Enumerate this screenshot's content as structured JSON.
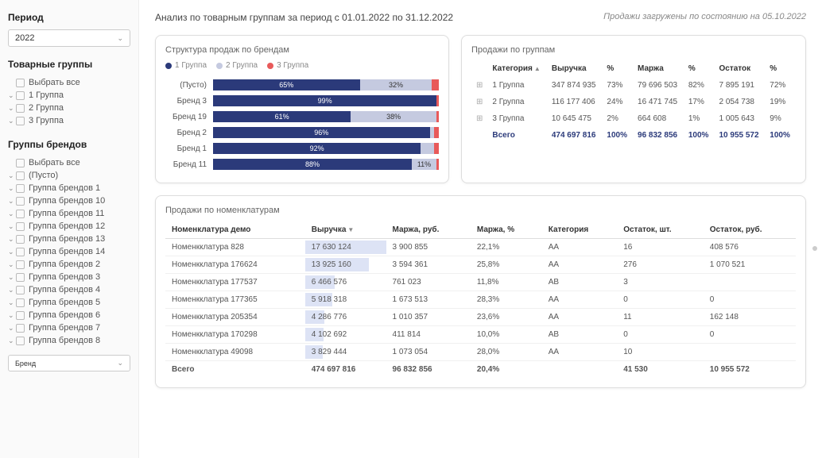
{
  "sidebar": {
    "period_label": "Период",
    "period_value": "2022",
    "groups_label": "Товарные группы",
    "select_all": "Выбрать все",
    "groups": [
      "1 Группа",
      "2 Группа",
      "3 Группа"
    ],
    "brands_label": "Группы брендов",
    "empty": "(Пусто)",
    "brand_groups": [
      "Группа брендов 1",
      "Группа брендов 10",
      "Группа брендов 11",
      "Группа брендов 12",
      "Группа брендов 13",
      "Группа брендов 14",
      "Группа брендов 2",
      "Группа брендов 3",
      "Группа брендов 4",
      "Группа брендов 5",
      "Группа брендов 6",
      "Группа брендов 7",
      "Группа брендов 8"
    ],
    "dropdown": "Бренд"
  },
  "header": {
    "title": "Анализ по товарным группам за период с 01.01.2022 по 31.12.2022",
    "loaded": "Продажи загружены по состоянию на 05.10.2022"
  },
  "chart": {
    "title": "Структура продаж по брендам",
    "legend": {
      "g1": "1 Группа",
      "g2": "2 Группа",
      "g3": "3 Группа"
    }
  },
  "chart_data": {
    "type": "bar",
    "orientation": "horizontal-stacked",
    "categories": [
      "(Пусто)",
      "Бренд 3",
      "Бренд 19",
      "Бренд 2",
      "Бренд 1",
      "Бренд 11"
    ],
    "series": [
      {
        "name": "1 Группа",
        "color": "#2b3a7a",
        "values": [
          65,
          99,
          61,
          96,
          92,
          88
        ]
      },
      {
        "name": "2 Группа",
        "color": "#c5cae0",
        "values": [
          32,
          0,
          38,
          2,
          6,
          11
        ]
      },
      {
        "name": "3 Группа",
        "color": "#e85a5a",
        "values": [
          3,
          1,
          1,
          2,
          2,
          1
        ]
      }
    ],
    "labels": [
      [
        "65%",
        "32%",
        ""
      ],
      [
        "99%",
        "",
        ""
      ],
      [
        "61%",
        "38%",
        ""
      ],
      [
        "96%",
        "",
        ""
      ],
      [
        "92%",
        "",
        ""
      ],
      [
        "88%",
        "11%",
        ""
      ]
    ]
  },
  "groups_table": {
    "title": "Продажи по группам",
    "headers": [
      "Категория",
      "Выручка",
      "%",
      "Маржа",
      "%",
      "Остаток",
      "%"
    ],
    "rows": [
      {
        "cat": "1 Группа",
        "rev": "347 874 935",
        "revp": "73%",
        "mar": "79 696 503",
        "marp": "82%",
        "rem": "7 895 191",
        "remp": "72%"
      },
      {
        "cat": "2 Группа",
        "rev": "116 177 406",
        "revp": "24%",
        "mar": "16 471 745",
        "marp": "17%",
        "rem": "2 054 738",
        "remp": "19%"
      },
      {
        "cat": "3 Группа",
        "rev": "10 645 475",
        "revp": "2%",
        "mar": "664 608",
        "marp": "1%",
        "rem": "1 005 643",
        "remp": "9%"
      }
    ],
    "total": {
      "cat": "Всего",
      "rev": "474 697 816",
      "revp": "100%",
      "mar": "96 832 856",
      "marp": "100%",
      "rem": "10 955 572",
      "remp": "100%"
    }
  },
  "nom_table": {
    "title": "Продажи по номенклатурам",
    "headers": [
      "Номенклатура демо",
      "Выручка",
      "Маржа, руб.",
      "Маржа, %",
      "Категория",
      "Остаток, шт.",
      "Остаток, руб."
    ],
    "rows": [
      {
        "n": "Номенкклатура 828",
        "rev": "17 630 124",
        "bar": 100,
        "mar": "3 900 855",
        "mp": "22,1%",
        "cat": "AA",
        "qty": "16",
        "rr": "408 576"
      },
      {
        "n": "Номенкклатура 176624",
        "rev": "13 925 160",
        "bar": 79,
        "mar": "3 594 361",
        "mp": "25,8%",
        "cat": "AA",
        "qty": "276",
        "rr": "1 070 521"
      },
      {
        "n": "Номенкклатура 177537",
        "rev": "6 466 576",
        "bar": 37,
        "mar": "761 023",
        "mp": "11,8%",
        "cat": "AB",
        "qty": "3",
        "rr": ""
      },
      {
        "n": "Номенкклатура 177365",
        "rev": "5 918 318",
        "bar": 34,
        "mar": "1 673 513",
        "mp": "28,3%",
        "cat": "AA",
        "qty": "0",
        "rr": "0"
      },
      {
        "n": "Номенкклатура 205354",
        "rev": "4 286 776",
        "bar": 24,
        "mar": "1 010 357",
        "mp": "23,6%",
        "cat": "AA",
        "qty": "11",
        "rr": "162 148"
      },
      {
        "n": "Номенкклатура 170298",
        "rev": "4 102 692",
        "bar": 23,
        "mar": "411 814",
        "mp": "10,0%",
        "cat": "AB",
        "qty": "0",
        "rr": "0"
      },
      {
        "n": "Номенкклатура 49098",
        "rev": "3 829 444",
        "bar": 22,
        "mar": "1 073 054",
        "mp": "28,0%",
        "cat": "AA",
        "qty": "10",
        "rr": ""
      }
    ],
    "total": {
      "n": "Всего",
      "rev": "474 697 816",
      "mar": "96 832 856",
      "mp": "20,4%",
      "cat": "",
      "qty": "41 530",
      "rr": "10 955 572"
    }
  }
}
